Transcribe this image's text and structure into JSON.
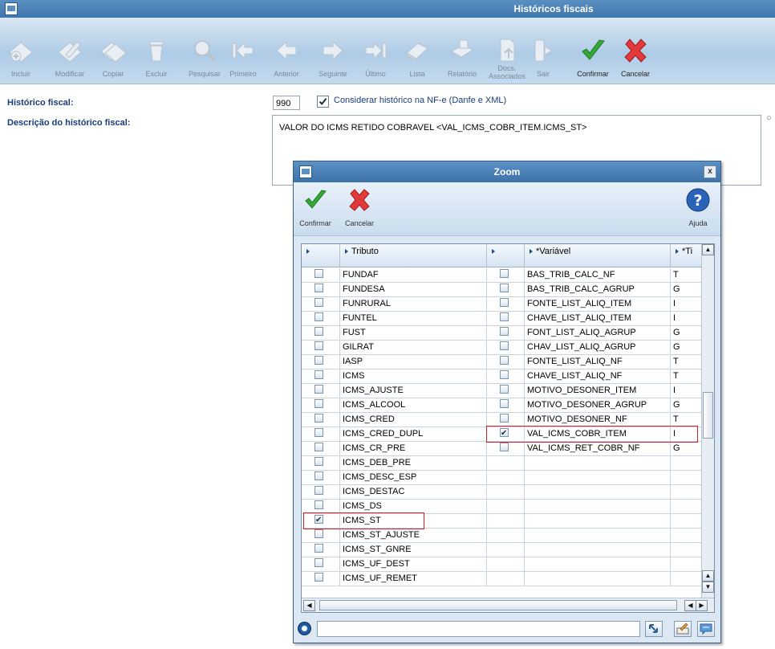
{
  "window": {
    "title": "Históricos fiscais"
  },
  "toolbar": {
    "buttons": [
      {
        "label": "Incluir",
        "icon": "add-disc-icon"
      },
      {
        "label": "Modificar",
        "icon": "edit-disc-icon"
      },
      {
        "label": "Copiar",
        "icon": "copy-disc-icon"
      },
      {
        "label": "Excluir",
        "icon": "trash-icon"
      },
      {
        "label": "Pesquisar",
        "icon": "magnifier-icon"
      },
      {
        "label": "Primeiro",
        "icon": "first-arrow-icon"
      },
      {
        "label": "Anterior",
        "icon": "previous-arrow-icon"
      },
      {
        "label": "Seguinte",
        "icon": "next-arrow-icon"
      },
      {
        "label": "Último",
        "icon": "last-arrow-icon"
      },
      {
        "label": "Lista",
        "icon": "book-icon"
      },
      {
        "label": "Relatório",
        "icon": "printer-icon"
      },
      {
        "label": "Docs.",
        "label2": "Associados",
        "icon": "documents-icon"
      },
      {
        "label": "Sair",
        "icon": "exit-door-icon"
      },
      {
        "label": "Confirmar",
        "icon": "green-check-icon"
      },
      {
        "label": "Cancelar",
        "icon": "red-x-icon"
      }
    ]
  },
  "form": {
    "historico_label": "Histórico fiscal:",
    "historico_code": "990",
    "considerar_label": "Considerar histórico na NF-e (Danfe e XML)",
    "considerar_checked": true,
    "descricao_label": "Descrição do histórico fiscal:",
    "descricao_value": "VALOR DO ICMS RETIDO COBRAVEL <VAL_ICMS_COBR_ITEM.ICMS_ST>"
  },
  "zoom": {
    "title": "Zoom",
    "close": "x",
    "confirm_label": "Confirmar",
    "cancel_label": "Cancelar",
    "help_label": "Ajuda",
    "columns": {
      "tributo": "Tributo",
      "variavel": "*Variável",
      "tipo": "*Ti"
    },
    "tributos": [
      {
        "name": "FUNDAF",
        "checked": false
      },
      {
        "name": "FUNDESA",
        "checked": false
      },
      {
        "name": "FUNRURAL",
        "checked": false
      },
      {
        "name": "FUNTEL",
        "checked": false
      },
      {
        "name": "FUST",
        "checked": false
      },
      {
        "name": "GILRAT",
        "checked": false
      },
      {
        "name": "IASP",
        "checked": false
      },
      {
        "name": "ICMS",
        "checked": false
      },
      {
        "name": "ICMS_AJUSTE",
        "checked": false
      },
      {
        "name": "ICMS_ALCOOL",
        "checked": false
      },
      {
        "name": "ICMS_CRED",
        "checked": false
      },
      {
        "name": "ICMS_CRED_DUPL",
        "checked": false
      },
      {
        "name": "ICMS_CR_PRE",
        "checked": false
      },
      {
        "name": "ICMS_DEB_PRE",
        "checked": false
      },
      {
        "name": "ICMS_DESC_ESP",
        "checked": false
      },
      {
        "name": "ICMS_DESTAC",
        "checked": false
      },
      {
        "name": "ICMS_DS",
        "checked": false
      },
      {
        "name": "ICMS_ST",
        "checked": true
      },
      {
        "name": "ICMS_ST_AJUSTE",
        "checked": false
      },
      {
        "name": "ICMS_ST_GNRE",
        "checked": false
      },
      {
        "name": "ICMS_UF_DEST",
        "checked": false
      },
      {
        "name": "ICMS_UF_REMET",
        "checked": false
      }
    ],
    "variaveis": [
      {
        "name": "BAS_TRIB_CALC_NF",
        "tipo": "T",
        "checked": false
      },
      {
        "name": "BAS_TRIB_CALC_AGRUP",
        "tipo": "G",
        "checked": false
      },
      {
        "name": "FONTE_LIST_ALIQ_ITEM",
        "tipo": "I",
        "checked": false
      },
      {
        "name": "CHAVE_LIST_ALIQ_ITEM",
        "tipo": "I",
        "checked": false
      },
      {
        "name": "FONT_LIST_ALIQ_AGRUP",
        "tipo": "G",
        "checked": false
      },
      {
        "name": "CHAV_LIST_ALIQ_AGRUP",
        "tipo": "G",
        "checked": false
      },
      {
        "name": "FONTE_LIST_ALIQ_NF",
        "tipo": "T",
        "checked": false
      },
      {
        "name": "CHAVE_LIST_ALIQ_NF",
        "tipo": "T",
        "checked": false
      },
      {
        "name": "MOTIVO_DESONER_ITEM",
        "tipo": "I",
        "checked": false
      },
      {
        "name": "MOTIVO_DESONER_AGRUP",
        "tipo": "G",
        "checked": false
      },
      {
        "name": "MOTIVO_DESONER_NF",
        "tipo": "T",
        "checked": false
      },
      {
        "name": "VAL_ICMS_COBR_ITEM",
        "tipo": "I",
        "checked": true
      },
      {
        "name": "VAL_ICMS_RET_COBR_NF",
        "tipo": "G",
        "checked": false
      }
    ]
  },
  "colors": {
    "title_bar": "#3f76ad",
    "label_blue": "#1a3d78",
    "highlight_red": "#d6202a"
  }
}
